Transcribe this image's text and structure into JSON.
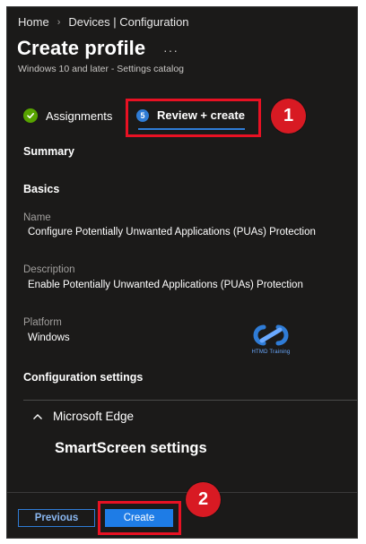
{
  "breadcrumb": {
    "home": "Home",
    "current": "Devices | Configuration"
  },
  "header": {
    "title": "Create profile",
    "more": "···",
    "subtitle": "Windows 10 and later - Settings catalog"
  },
  "tabs": [
    {
      "label": "Assignments",
      "state": "complete"
    },
    {
      "label": "Review + create",
      "step": "5",
      "state": "active"
    }
  ],
  "callouts": {
    "first": "1",
    "second": "2"
  },
  "summary": {
    "heading": "Summary",
    "basics_heading": "Basics",
    "fields": [
      {
        "label": "Name",
        "value": "Configure Potentially Unwanted Applications (PUAs) Protection"
      },
      {
        "label": "Description",
        "value": "Enable Potentially Unwanted Applications (PUAs) Protection"
      },
      {
        "label": "Platform",
        "value": "Windows"
      }
    ],
    "config_heading": "Configuration settings",
    "group": {
      "label": "Microsoft Edge",
      "expanded": true
    },
    "setting_title": "SmartScreen settings"
  },
  "watermark": {
    "text": "HTMD Training"
  },
  "footer": {
    "previous_label": "Previous",
    "create_label": "Create"
  },
  "colors": {
    "background": "#1b1a19",
    "accent": "#2f7cd6",
    "highlight": "#e81123",
    "success": "#57a300"
  }
}
